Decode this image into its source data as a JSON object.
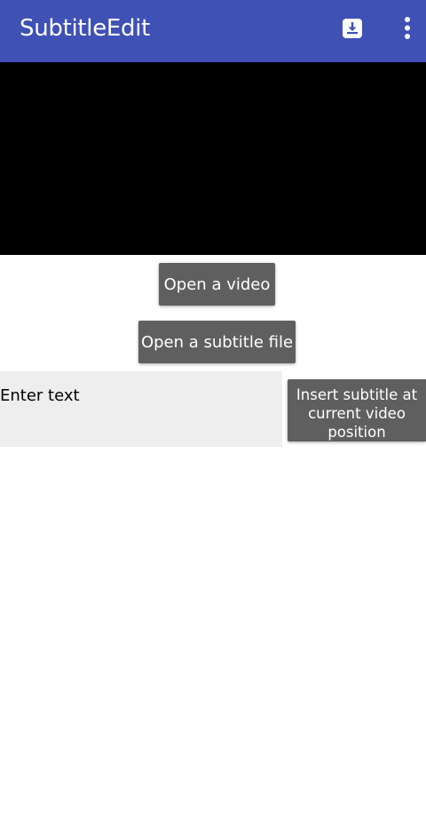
{
  "app_bar": {
    "title": "SubtitleEdit",
    "color": "#3f51b5",
    "actions": [
      {
        "icon": "save-download-icon"
      },
      {
        "icon": "more-vert-icon"
      }
    ]
  },
  "video": {
    "background": "#000000"
  },
  "buttons": {
    "open_video": "Open a video",
    "open_subtitle": "Open a subtitle file",
    "insert_subtitle": "Insert subtitle at current video position"
  },
  "text_input": {
    "placeholder": "Enter text",
    "value": ""
  }
}
